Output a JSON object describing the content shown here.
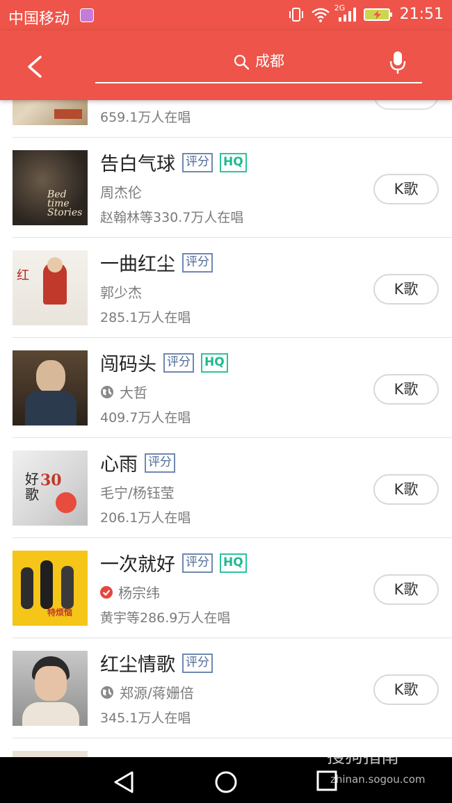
{
  "status_bar": {
    "carrier": "中国移动",
    "network": "2G",
    "time": "21:51",
    "icons": [
      "app-notification-icon",
      "vibrate-icon",
      "wifi-icon",
      "signal-icon",
      "battery-charging-icon"
    ]
  },
  "header": {
    "search_query": "成都",
    "icons": [
      "back-arrow-icon",
      "search-icon",
      "microphone-icon"
    ]
  },
  "colors": {
    "header_bg": "#ee5449",
    "tag_score": "#4f6a97",
    "tag_hq": "#1fb98f",
    "verified": "#e8453c"
  },
  "songs": [
    {
      "listeners": "659.1万人在唱",
      "cover_icon": "album-cover-image"
    },
    {
      "title": "告白气球",
      "score_tag": "评分",
      "hq_tag": "HQ",
      "artist": "周杰伦",
      "listeners": "赵翰林等330.7万人在唱",
      "button": "K歌",
      "cover_icon": "album-cover-image"
    },
    {
      "title": "一曲红尘",
      "score_tag": "评分",
      "artist": "郭少杰",
      "listeners": "285.1万人在唱",
      "button": "K歌",
      "cover_icon": "album-cover-image"
    },
    {
      "title": "闯码头",
      "score_tag": "评分",
      "hq_tag": "HQ",
      "artist": "大哲",
      "artist_icon": "globe-icon",
      "listeners": "409.7万人在唱",
      "button": "K歌",
      "cover_icon": "album-cover-image"
    },
    {
      "title": "心雨",
      "score_tag": "评分",
      "artist": "毛宁/杨钰莹",
      "listeners": "206.1万人在唱",
      "button": "K歌",
      "cover_icon": "album-cover-image"
    },
    {
      "title": "一次就好",
      "score_tag": "评分",
      "hq_tag": "HQ",
      "artist": "杨宗纬",
      "artist_icon": "verified-check-icon",
      "listeners": "黄宇等286.9万人在唱",
      "button": "K歌",
      "cover_icon": "album-cover-image"
    },
    {
      "title": "红尘情歌",
      "score_tag": "评分",
      "artist": "郑源/蒋姗倍",
      "artist_icon": "globe-icon",
      "listeners": "345.1万人在唱",
      "button": "K歌",
      "cover_icon": "album-cover-image"
    }
  ],
  "nav_bar": {
    "icons": [
      "back-triangle-icon",
      "home-circle-icon",
      "recent-apps-square-icon"
    ]
  },
  "watermark": {
    "brand": "搜狗指南",
    "url": "zhinan.sogou.com"
  }
}
